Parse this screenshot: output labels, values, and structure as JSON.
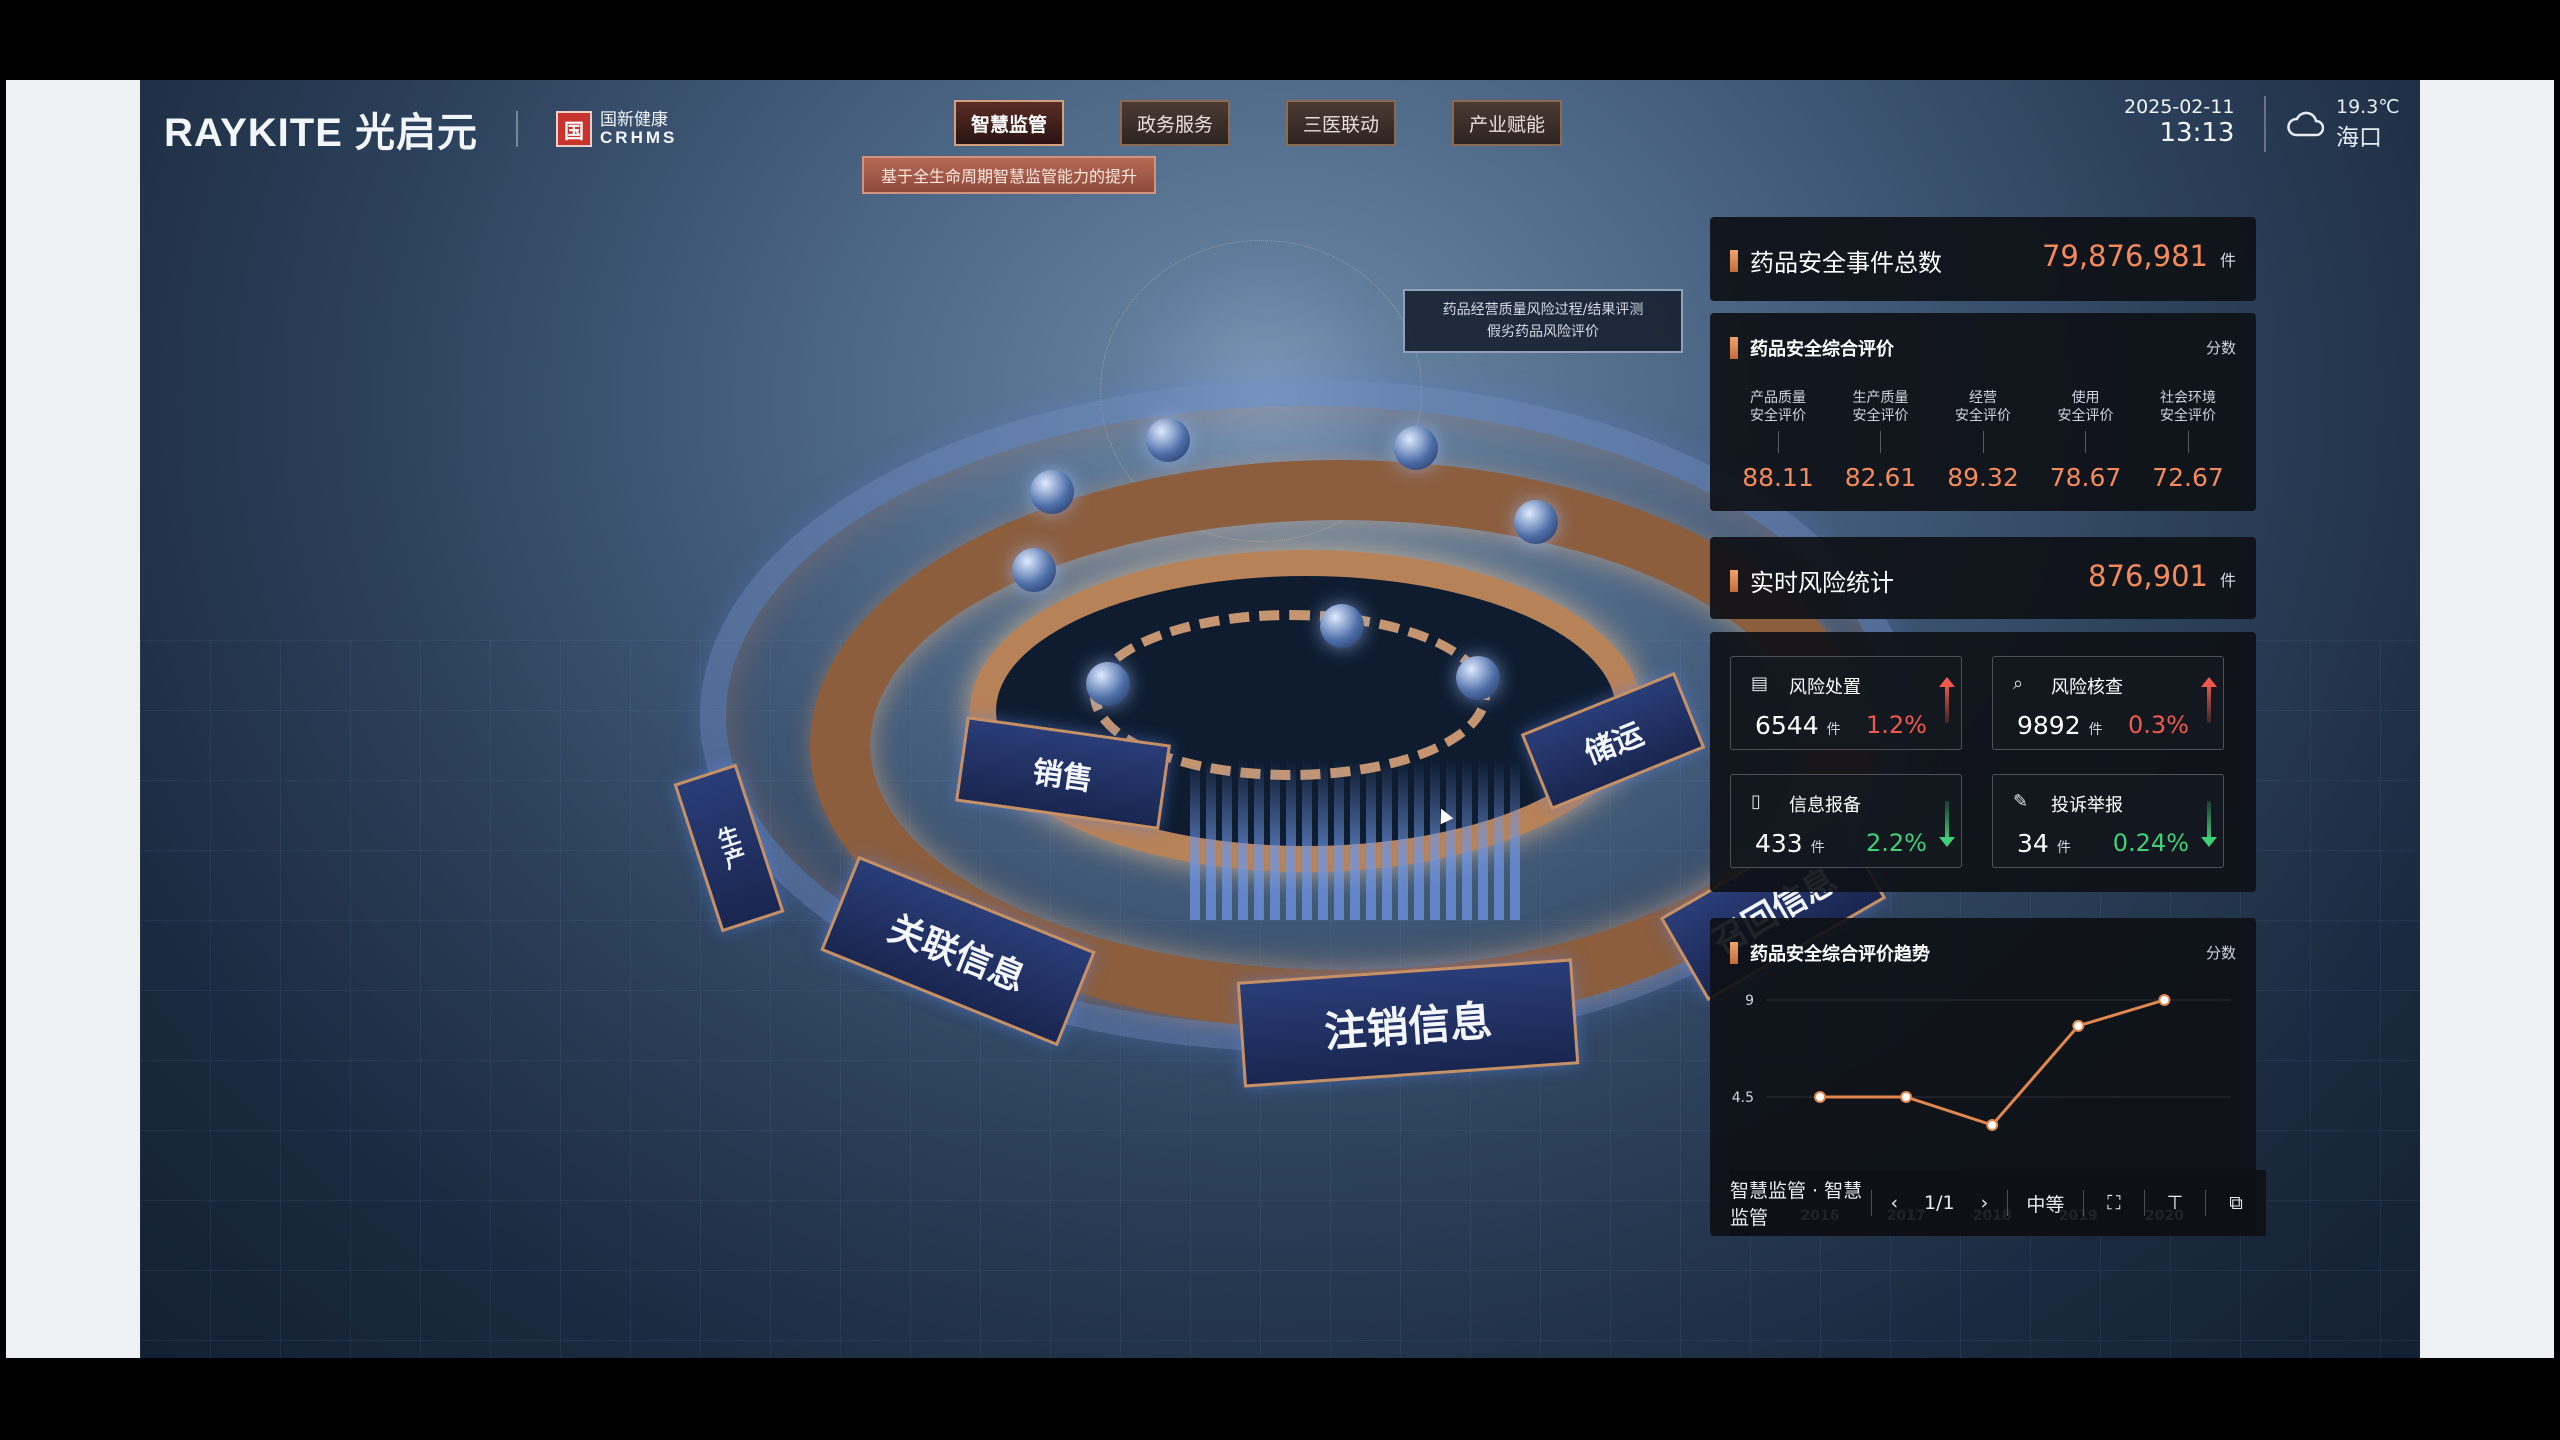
{
  "header": {
    "logo_text": "RAYKITE 光启元",
    "partner_mark": "国",
    "partner_cn": "国新健康",
    "partner_en": "CRHMS",
    "tabs": [
      {
        "label": "智慧监管",
        "active": true
      },
      {
        "label": "政务服务",
        "active": false
      },
      {
        "label": "三医联动",
        "active": false
      },
      {
        "label": "产业赋能",
        "active": false
      }
    ],
    "tab_tooltip": "基于全生命周期智慧监管能力的提升",
    "date": "2025-02-11",
    "time": "13:13",
    "temperature": "19.3℃",
    "city": "海口",
    "weather_icon": "cloud-icon"
  },
  "scene": {
    "tooltip_line1": "药品经营质量风险过程/结果评测",
    "tooltip_line2": "假劣药品风险评价",
    "ring_labels": [
      "销售",
      "储运",
      "关联信息",
      "注销信息",
      "召回信息",
      "生产"
    ]
  },
  "panels": {
    "total_events": {
      "title": "药品安全事件总数",
      "value": "79,876,981",
      "unit": "件"
    },
    "composite": {
      "title": "药品安全综合评价",
      "unit": "分数",
      "items": [
        {
          "label_line1": "产品质量",
          "label_line2": "安全评价",
          "value": "88.11"
        },
        {
          "label_line1": "生产质量",
          "label_line2": "安全评价",
          "value": "82.61"
        },
        {
          "label_line1": "经营",
          "label_line2": "安全评价",
          "value": "89.32"
        },
        {
          "label_line1": "使用",
          "label_line2": "安全评价",
          "value": "78.67"
        },
        {
          "label_line1": "社会环境",
          "label_line2": "安全评价",
          "value": "72.67"
        }
      ]
    },
    "realtime_risk": {
      "title": "实时风险统计",
      "value": "876,901",
      "unit": "件"
    },
    "risk_cards": [
      {
        "title": "风险处置",
        "value": "6544",
        "unit": "件",
        "pct": "1.2%",
        "trend": "up",
        "icon": "document-icon"
      },
      {
        "title": "风险核查",
        "value": "9892",
        "unit": "件",
        "pct": "0.3%",
        "trend": "up",
        "icon": "search-doc-icon"
      },
      {
        "title": "信息报备",
        "value": "433",
        "unit": "件",
        "pct": "2.2%",
        "trend": "down",
        "icon": "report-icon"
      },
      {
        "title": "投诉举报",
        "value": "34",
        "unit": "件",
        "pct": "0.24%",
        "trend": "down",
        "icon": "edit-icon"
      }
    ],
    "trend": {
      "title": "药品安全综合评价趋势",
      "unit": "分数"
    }
  },
  "chart_data": {
    "type": "line",
    "title": "药品安全综合评价趋势",
    "categories": [
      "2016",
      "2017",
      "2018",
      "2019",
      "2020"
    ],
    "values": [
      4.5,
      4.5,
      3.2,
      7.8,
      9.0
    ],
    "yticks": [
      "0",
      "4.5",
      "9"
    ],
    "ylim": [
      0,
      9
    ],
    "ylabel": "分数",
    "line_color": "#e0864f",
    "grid": true
  },
  "toolbar": {
    "breadcrumb": "智慧监管 · 智慧监管",
    "page": "1/1",
    "quality": "中等",
    "prev_icon": "chevron-left-icon",
    "next_icon": "chevron-right-icon",
    "fullscreen_icon": "fullscreen-icon",
    "pin_icon": "pin-icon",
    "window_icon": "window-icon"
  },
  "colors": {
    "accent_orange": "#f38a5c",
    "up_red": "#f0584e",
    "down_green": "#41d07a",
    "panel_bg": "#0e1016"
  }
}
